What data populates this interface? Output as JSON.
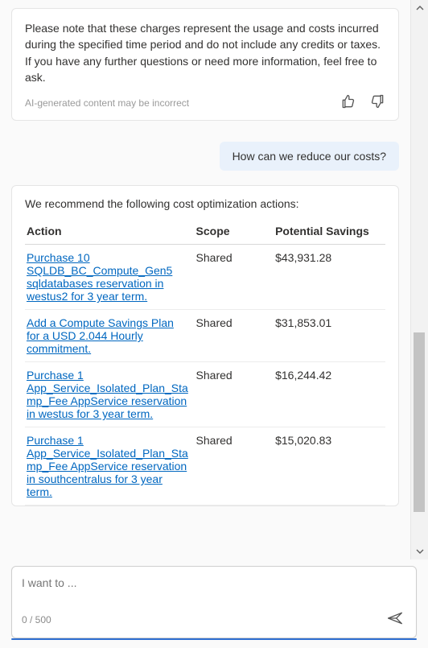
{
  "assistant_prev": {
    "text": "Please note that these charges represent the usage and costs incurred during the specified time period and do not include any credits or taxes. If you have any further questions or need more information, feel free to ask.",
    "disclaimer": "AI-generated content may be incorrect"
  },
  "user_message": "How can we reduce our costs?",
  "recommendation": {
    "intro": "We recommend the following cost optimization actions:",
    "columns": {
      "action": "Action",
      "scope": "Scope",
      "savings": "Potential Savings"
    },
    "rows": [
      {
        "action": "Purchase 10 SQLDB_BC_Compute_Gen5 sqldatabases reservation in westus2 for 3 year term.",
        "scope": "Shared",
        "savings": "$43,931.28"
      },
      {
        "action": "Add a Compute Savings Plan for a USD 2.044 Hourly commitment.",
        "scope": "Shared",
        "savings": "$31,853.01"
      },
      {
        "action": "Purchase 1 App_Service_Isolated_Plan_Stamp_Fee AppService reservation in westus for 3 year term.",
        "scope": "Shared",
        "savings": "$16,244.42"
      },
      {
        "action": "Purchase 1 App_Service_Isolated_Plan_Stamp_Fee AppService reservation in southcentralus for 3 year term.",
        "scope": "Shared",
        "savings": "$15,020.83"
      }
    ]
  },
  "input": {
    "placeholder": "I want to ...",
    "counter": "0 / 500"
  },
  "icons": {
    "thumbs_up": "thumbs-up-icon",
    "thumbs_down": "thumbs-down-icon",
    "send": "send-icon",
    "scroll_up": "scroll-up-icon",
    "scroll_down": "scroll-down-icon"
  }
}
